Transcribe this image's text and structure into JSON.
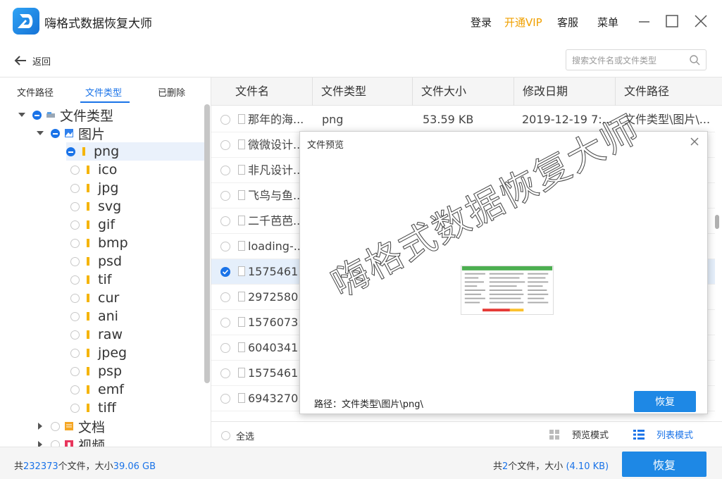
{
  "app": {
    "title": "嗨格式数据恢复大师"
  },
  "titlebar": {
    "login": "登录",
    "vip": "开通VIP",
    "service": "客服",
    "menu": "菜单"
  },
  "toolbar": {
    "back_label": "返回",
    "search_placeholder": "搜索文件名或文件类型"
  },
  "left_tabs": [
    {
      "label": "文件路径",
      "active": false
    },
    {
      "label": "文件类型",
      "active": true
    },
    {
      "label": "已删除",
      "active": false
    }
  ],
  "tree": {
    "root": "文件类型",
    "images": "图片",
    "formats": [
      "png",
      "ico",
      "jpg",
      "svg",
      "gif",
      "bmp",
      "psd",
      "tif",
      "cur",
      "ani",
      "raw",
      "jpeg",
      "psp",
      "emf",
      "tiff"
    ],
    "documents": "文档",
    "videos": "视频"
  },
  "table": {
    "columns": [
      "文件名",
      "文件类型",
      "文件大小",
      "修改日期",
      "文件路径"
    ],
    "rows": [
      {
        "name": "那年的海...",
        "type": "png",
        "size": "53.59 KB",
        "date": "2019-12-19 7:...",
        "path": "文件类型\\图片\\...",
        "checked": false
      },
      {
        "name": "微微设计...",
        "checked": false
      },
      {
        "name": "非凡设计...",
        "checked": false
      },
      {
        "name": "飞鸟与鱼...",
        "checked": false
      },
      {
        "name": "二千芭芭...",
        "checked": false
      },
      {
        "name": "loading-...",
        "checked": false
      },
      {
        "name": "1575461...",
        "checked": true
      },
      {
        "name": "2972580...",
        "checked": false
      },
      {
        "name": "1576073...",
        "checked": false
      },
      {
        "name": "6040341...",
        "checked": false
      },
      {
        "name": "1575461...",
        "checked": false
      },
      {
        "name": "6943270...",
        "checked": false
      }
    ]
  },
  "bottom": {
    "select_all": "全选",
    "preview_mode": "预览模式",
    "list_mode": "列表模式"
  },
  "status": {
    "total_prefix": "共",
    "total_count": "232373",
    "total_mid": "个文件，大小",
    "total_size": "39.06 GB",
    "sel_prefix": "共",
    "sel_count": "2",
    "sel_mid": "个文件，大小",
    "sel_size": "(4.10 KB)",
    "recover": "恢复"
  },
  "modal": {
    "title": "文件预览",
    "path": "路径：文件类型\\图片\\png\\",
    "recover": "恢复"
  },
  "watermark": "嗨格式数据恢复大师",
  "colors": {
    "accent": "#1a73e8",
    "button": "#1e88e5",
    "vip": "#f0a000"
  }
}
